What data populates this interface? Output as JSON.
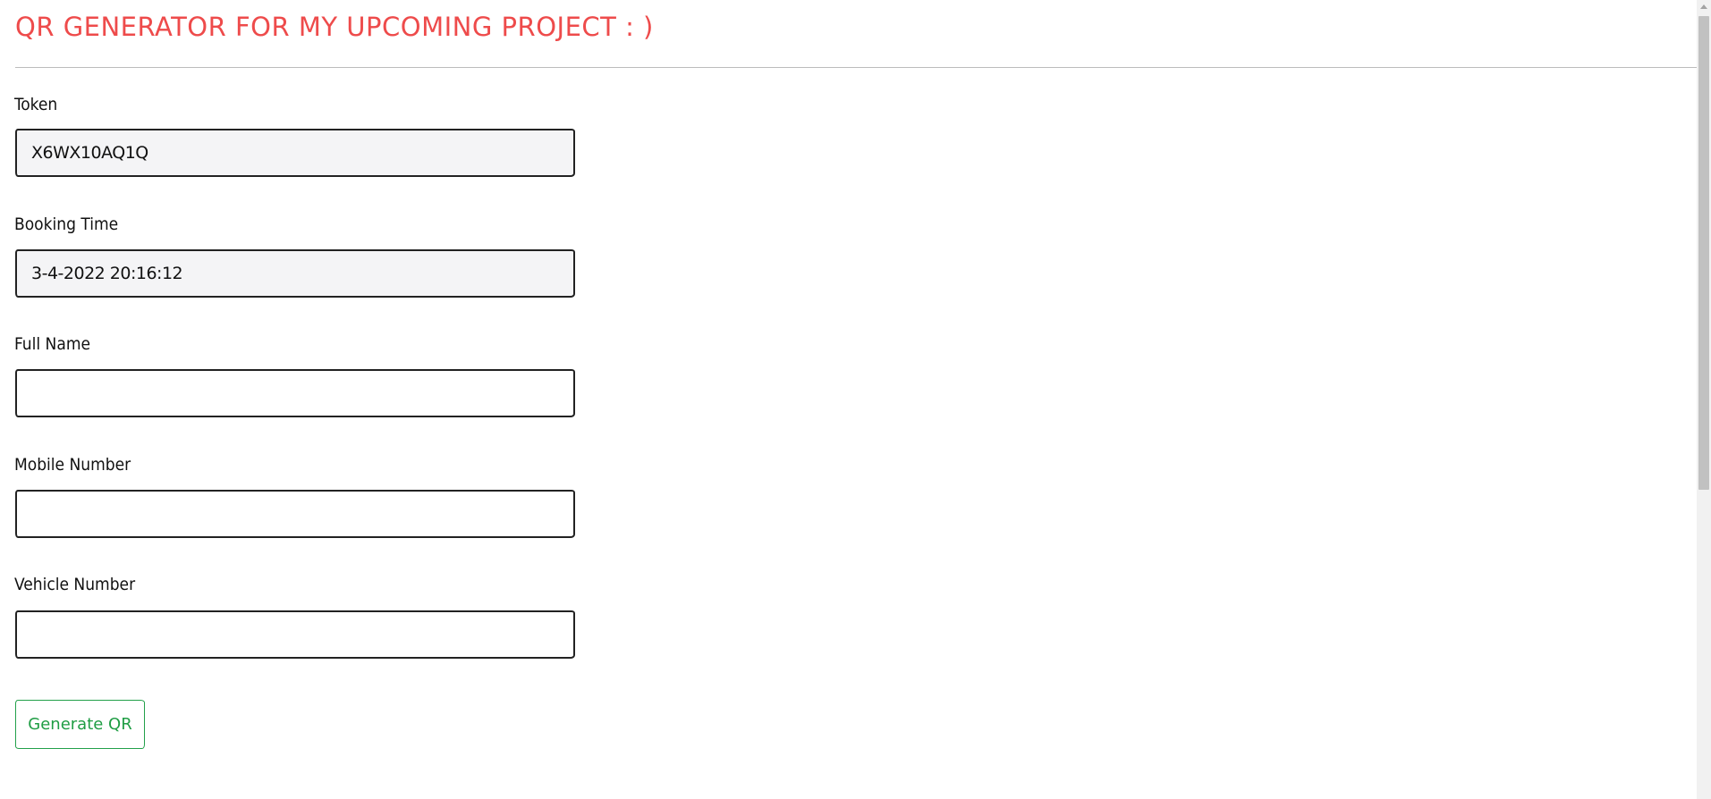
{
  "header": {
    "title": "QR GENERATOR FOR MY UPCOMING PROJECT : )"
  },
  "form": {
    "token": {
      "label": "Token",
      "value": "X6WX10AQ1Q"
    },
    "booking_time": {
      "label": "Booking Time",
      "value": "3-4-2022 20:16:12"
    },
    "full_name": {
      "label": "Full Name",
      "value": ""
    },
    "mobile_number": {
      "label": "Mobile Number",
      "value": ""
    },
    "vehicle_number": {
      "label": "Vehicle Number",
      "value": ""
    },
    "submit_label": "Generate QR"
  },
  "colors": {
    "title": "#ee4b4b",
    "button": "#1f9d44",
    "readonly_bg": "#f4f4f6"
  }
}
